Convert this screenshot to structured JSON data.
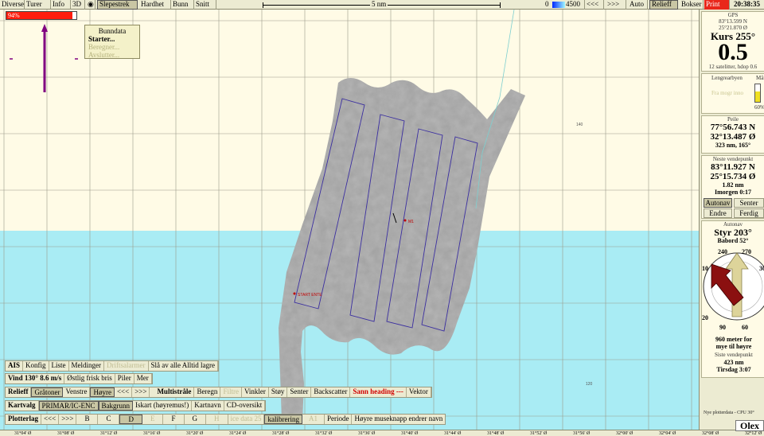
{
  "topbar": {
    "menus": [
      "Diverse",
      "Turer",
      "Info",
      "3D",
      "Slepestrek",
      "Hardhet",
      "Bunn",
      "Snitt"
    ],
    "scale_label": "5 nm",
    "depth_min": "0",
    "depth_max": "4500",
    "nav_prev": "<<<",
    "nav_next": ">>>",
    "auto": "Auto",
    "relieff": "Relieff",
    "bokser": "Bokser",
    "print": "Print",
    "time": "20:38:35"
  },
  "progress": {
    "label": "94%",
    "value": 0.94
  },
  "popup": {
    "title": "Bunndata",
    "items": [
      {
        "label": "Starter...",
        "state": "bold"
      },
      {
        "label": "Beregner...",
        "state": "disabled"
      },
      {
        "label": "Avslutter...",
        "state": "disabled"
      }
    ]
  },
  "map": {
    "label_start": "START ENTE",
    "label_mark": "M1",
    "depth_labels": [
      "140",
      "120"
    ]
  },
  "gps": {
    "title": "GPS",
    "lat": "83°13.599 N",
    "lon": "25°21.870 Ø",
    "course_label": "Kurs 255°",
    "speed": "0.5",
    "satellites": "12 satelitter, hdop 0.6"
  },
  "gauges": {
    "left_title": "Lengrearbyen",
    "left_sub": "Fra mogr inno",
    "right_title": "Månr",
    "percent": "60%"
  },
  "peile": {
    "title": "Peile",
    "lat": "77°56.743 N",
    "lon": "32°13.487 Ø",
    "dist": "323 nm, 165°"
  },
  "waypoint": {
    "title": "Neste vendepunkt",
    "lat": "83°11.927 N",
    "lon": "25°15.734 Ø",
    "dist": "1.82 nm",
    "eta": "Imorgen 0:17",
    "buttons": [
      "Autonav",
      "Senter",
      "Endre",
      "Ferdig"
    ]
  },
  "autopilot": {
    "title": "Autonav",
    "steer": "Styr 203°",
    "port": "Babord 52°",
    "compass": [
      "240",
      "270",
      "10",
      "30",
      "20",
      "90",
      "60"
    ],
    "advice": "960 meter for",
    "advice2": "mye til høyre",
    "last_title": "Siste vendepunkt",
    "last_dist": "423 nm",
    "last_time": "Tirsdag 3:07"
  },
  "plotnote": "Nye plotterdata - CPU 30°",
  "olex": "Olex",
  "toolbar": {
    "ais": [
      "AIS",
      "Konfig",
      "Liste",
      "Meldinger",
      "Driftsalarmer",
      "Slå av alle Alltid lagre"
    ],
    "wind": [
      "Vind 130° 8.6 m/s",
      "Østlig frisk bris",
      "Piler",
      "Mer"
    ],
    "relieff": [
      "Relieff",
      "Gråtoner",
      "Venstre",
      "Høyre",
      "<<<",
      ">>>"
    ],
    "multi": [
      "Multistråle",
      "Beregn",
      "Filtre",
      "Vinkler",
      "Støy",
      "Senter",
      "Backscatter",
      "Sann heading ---",
      "Vektor"
    ],
    "kart": [
      "Kartvalg",
      "PRIMAR/IC-ENC",
      "Bakgrunn",
      "Iskart (høyremus!)",
      "Kartnavn",
      "CD-oversikt"
    ],
    "plotter": [
      "Plotterlag",
      "<<<",
      ">>>",
      "B",
      "C",
      "D",
      "E",
      "F",
      "G",
      "H",
      "ice data 25",
      "kalibrering",
      "A1",
      "Periode",
      "Høyre museknapp endrer navn"
    ]
  },
  "longitudes": [
    "31°04' Ø",
    "31°08' Ø",
    "31°12' Ø",
    "31°16' Ø",
    "31°20' Ø",
    "31°24' Ø",
    "31°28' Ø",
    "31°32' Ø",
    "31°36' Ø",
    "31°40' Ø",
    "31°44' Ø",
    "31°48' Ø",
    "31°52' Ø",
    "31°56' Ø",
    "32°00' Ø",
    "32°04' Ø",
    "32°08' Ø",
    "32°12' Ø"
  ]
}
